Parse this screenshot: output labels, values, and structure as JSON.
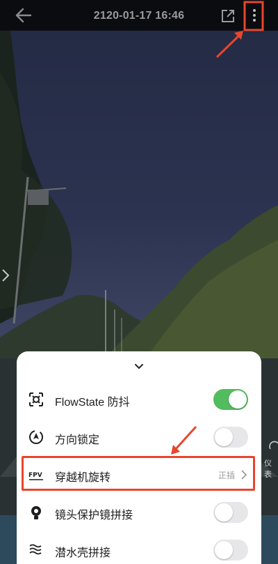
{
  "header": {
    "title": "2120-01-17 16:46"
  },
  "colors": {
    "accent_green": "#52bc5e",
    "annotation_red": "#e8452e"
  },
  "side": {
    "label": "仪表"
  },
  "sheet": {
    "items": [
      {
        "label": "FlowState 防抖",
        "icon": "flowstate-icon",
        "control": "toggle",
        "on": true
      },
      {
        "label": "方向锁定",
        "icon": "direction-lock-icon",
        "control": "toggle",
        "on": false
      },
      {
        "label": "穿越机旋转",
        "icon": "fpv-icon",
        "control": "select",
        "value": "正插"
      },
      {
        "label": "镜头保护镜拼接",
        "icon": "lens-guard-icon",
        "control": "toggle",
        "on": false
      },
      {
        "label": "潜水壳拼接",
        "icon": "dive-case-icon",
        "control": "toggle",
        "on": false
      }
    ]
  }
}
